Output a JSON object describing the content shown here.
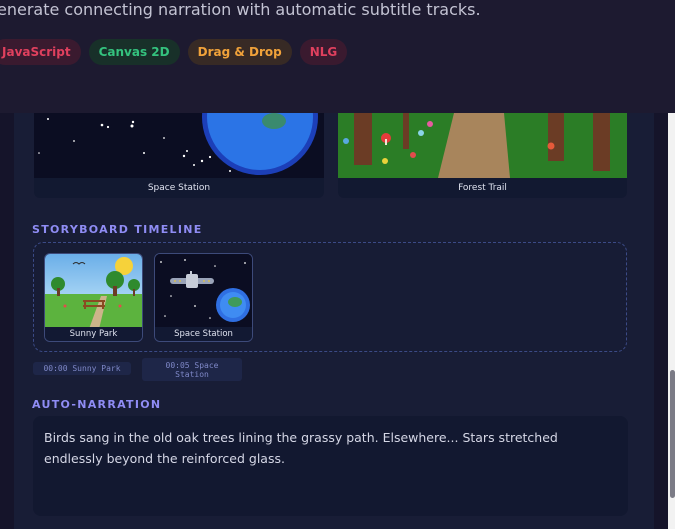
{
  "header": {
    "subtitle": "enerate connecting narration with automatic subtitle tracks.",
    "tags": [
      {
        "label": "JavaScript",
        "color": "#e0405e",
        "bg": "#3a1a2f"
      },
      {
        "label": "Canvas 2D",
        "color": "#34c27e",
        "bg": "#183029"
      },
      {
        "label": "Drag & Drop",
        "color": "#f0a23a",
        "bg": "#372a25"
      },
      {
        "label": "NLG",
        "color": "#e0405e",
        "bg": "#3a1a2f"
      }
    ]
  },
  "scenes": [
    {
      "label": "Space Station"
    },
    {
      "label": "Forest Trail"
    }
  ],
  "timeline": {
    "title": "STORYBOARD TIMELINE",
    "clips": [
      {
        "label": "Sunny Park"
      },
      {
        "label": "Space Station"
      }
    ],
    "timestamps": [
      {
        "text": "00:00 Sunny Park"
      },
      {
        "line1": "00:05 Space",
        "line2": "Station"
      }
    ]
  },
  "narration": {
    "title": "AUTO-NARRATION",
    "text": "Birds sang in the old oak trees lining the grassy path. Elsewhere... Stars stretched endlessly beyond the reinforced glass."
  }
}
